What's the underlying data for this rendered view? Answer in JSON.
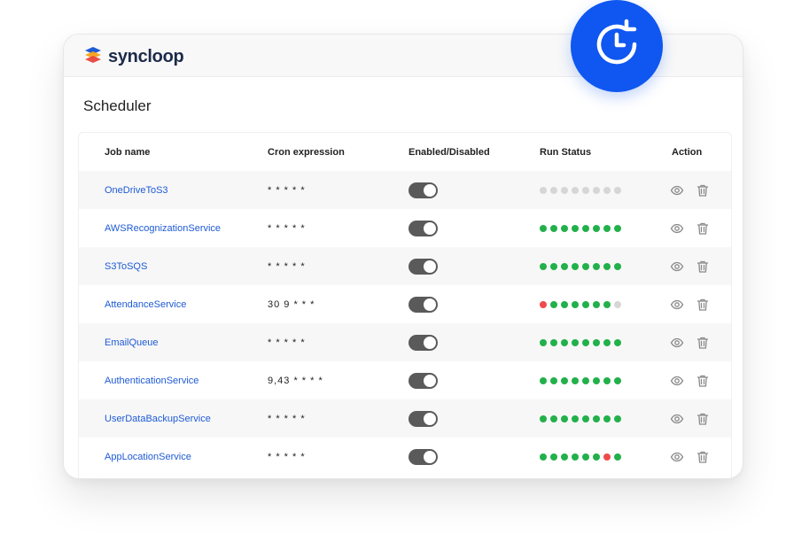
{
  "brand": {
    "name_prefix": "sync",
    "name_suffix": "loop"
  },
  "page": {
    "title": "Scheduler"
  },
  "table": {
    "headers": {
      "job_name": "Job name",
      "cron": "Cron expression",
      "enabled": "Enabled/Disabled",
      "run_status": "Run Status",
      "action": "Action"
    },
    "rows": [
      {
        "job": "OneDriveToS3",
        "cron": "* * * * *",
        "enabled": true,
        "status": [
          "gray",
          "gray",
          "gray",
          "gray",
          "gray",
          "gray",
          "gray",
          "gray"
        ]
      },
      {
        "job": "AWSRecognizationService",
        "cron": "* * * * *",
        "enabled": true,
        "status": [
          "green",
          "green",
          "green",
          "green",
          "green",
          "green",
          "green",
          "green"
        ]
      },
      {
        "job": "S3ToSQS",
        "cron": "* * * * *",
        "enabled": true,
        "status": [
          "green",
          "green",
          "green",
          "green",
          "green",
          "green",
          "green",
          "green"
        ]
      },
      {
        "job": "AttendanceService",
        "cron": "30 9 * * *",
        "enabled": true,
        "status": [
          "red",
          "green",
          "green",
          "green",
          "green",
          "green",
          "green",
          "gray"
        ]
      },
      {
        "job": "EmailQueue",
        "cron": "* * * * *",
        "enabled": true,
        "status": [
          "green",
          "green",
          "green",
          "green",
          "green",
          "green",
          "green",
          "green"
        ]
      },
      {
        "job": "AuthenticationService",
        "cron": "9,43 * * * *",
        "enabled": true,
        "status": [
          "green",
          "green",
          "green",
          "green",
          "green",
          "green",
          "green",
          "green"
        ]
      },
      {
        "job": "UserDataBackupService",
        "cron": "* * * * *",
        "enabled": true,
        "status": [
          "green",
          "green",
          "green",
          "green",
          "green",
          "green",
          "green",
          "green"
        ]
      },
      {
        "job": "AppLocationService",
        "cron": "* * * * *",
        "enabled": true,
        "status": [
          "green",
          "green",
          "green",
          "green",
          "green",
          "green",
          "red",
          "green"
        ]
      }
    ]
  },
  "colors": {
    "status_green": "#22b04a",
    "status_red": "#ef4b4b",
    "status_gray": "#d6d6d6",
    "link_blue": "#1e5bd6",
    "badge_blue": "#0f57f0"
  },
  "icons": {
    "badge": "clock-refresh-icon",
    "view": "eye-icon",
    "delete": "trash-icon",
    "logo": "syncloop-logo-icon"
  }
}
